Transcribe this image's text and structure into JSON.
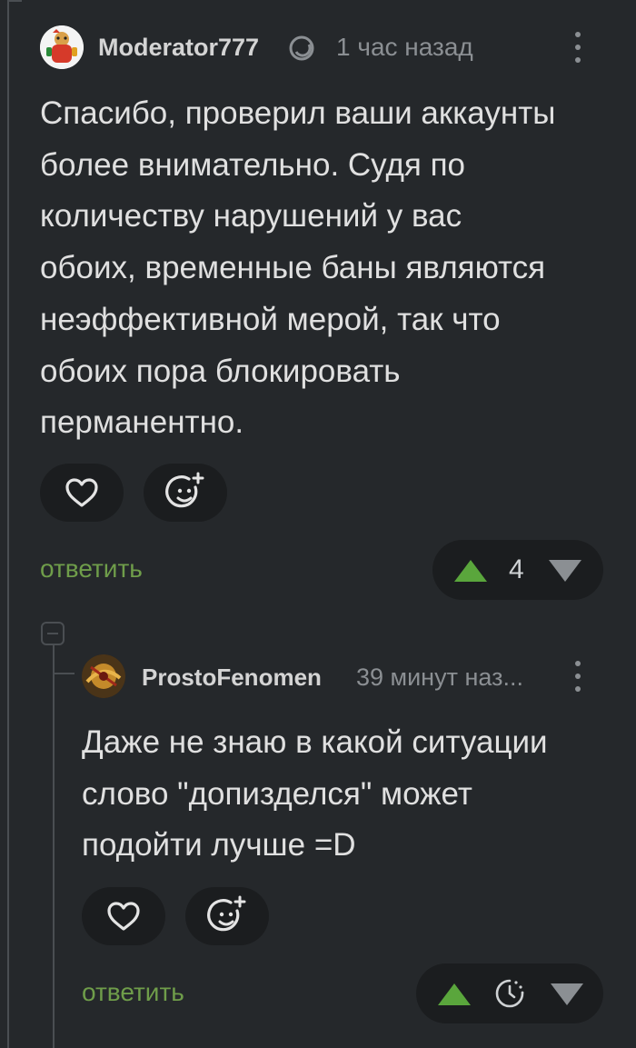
{
  "comment1": {
    "username": "Moderator777",
    "time": "1 час назад",
    "text": "Спасибо, проверил ваши аккаунты\nболее внимательно. Судя по\nколичеству нарушений у вас\nобоих, временные баны являются\nнеэффективной мерой, так что\nобоих пора блокировать\nперманентно.",
    "reply_label": "ответить",
    "rating": "4",
    "user_icon": "moderator-badge-icon"
  },
  "comment2": {
    "username": "ProstoFenomen",
    "time": "39 минут наз...",
    "text": "Даже не знаю в какой ситуации\nслово \"допизделся\" может\nподойти лучше =D",
    "reply_label": "ответить",
    "rating_icon": "clock-icon"
  },
  "colors": {
    "background": "#25282b",
    "upvote": "#5aa63c",
    "downvote": "#8b8f93",
    "reply": "#6f9d4a"
  }
}
